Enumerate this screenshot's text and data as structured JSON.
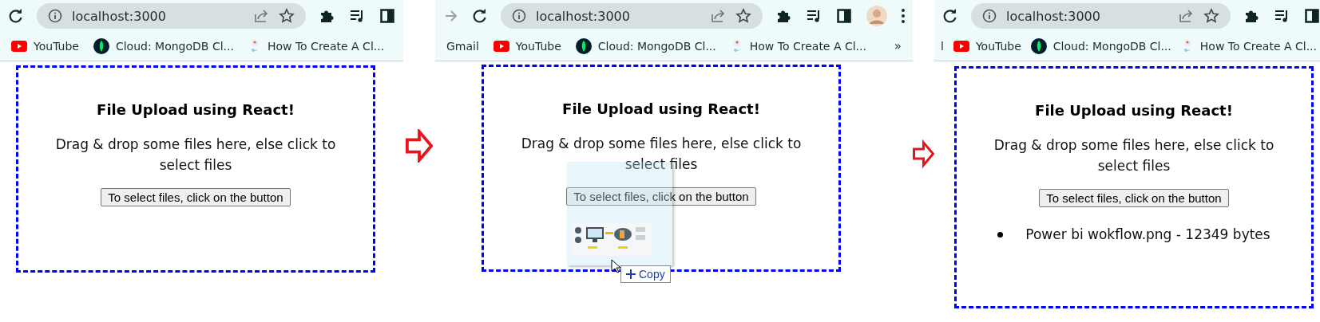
{
  "panels": [
    {
      "toolbar": {
        "nav": [
          {
            "kind": "reload",
            "disabled": false
          }
        ],
        "url": "localhost:3000",
        "actions": [
          {
            "kind": "extensions"
          },
          {
            "kind": "media"
          },
          {
            "kind": "sidepanel"
          }
        ]
      },
      "bookmarks": [
        {
          "label": "YouTube",
          "kind": "youtube"
        },
        {
          "label": "Cloud: MongoDB Cl...",
          "kind": "mongodb"
        },
        {
          "label": "How To Create A Cl...",
          "kind": "site"
        }
      ],
      "card": {
        "title": "File Upload using React!",
        "text": "Drag & drop some files here, else click to select files",
        "button": "To select files, click on the button"
      }
    },
    {
      "toolbar": {
        "nav": [
          {
            "kind": "forward",
            "disabled": true
          },
          {
            "kind": "reload",
            "disabled": false
          }
        ],
        "url": "localhost:3000",
        "actions": [
          {
            "kind": "extensions"
          },
          {
            "kind": "media"
          },
          {
            "kind": "sidepanel"
          },
          {
            "kind": "avatar"
          },
          {
            "kind": "menu"
          }
        ]
      },
      "bookmarks": [
        {
          "label": "Gmail",
          "kind": "plain"
        },
        {
          "label": "YouTube",
          "kind": "youtube"
        },
        {
          "label": "Cloud: MongoDB Cl...",
          "kind": "mongodb"
        },
        {
          "label": "How To Create A Cl...",
          "kind": "site"
        }
      ],
      "overflow": "»",
      "card": {
        "title": "File Upload using React!",
        "text": "Drag & drop some files here, else click to select files",
        "button": "To select files, click on the button"
      },
      "drag": {
        "action": "Copy"
      }
    },
    {
      "toolbar": {
        "nav": [
          {
            "kind": "reload",
            "disabled": false
          }
        ],
        "url": "localhost:3000",
        "actions": [
          {
            "kind": "extensions"
          },
          {
            "kind": "media"
          },
          {
            "kind": "sidepanel"
          }
        ]
      },
      "bookmarks": [
        {
          "label": "l",
          "kind": "plain"
        },
        {
          "label": "YouTube",
          "kind": "youtube"
        },
        {
          "label": "Cloud: MongoDB Cl...",
          "kind": "mongodb"
        },
        {
          "label": "How To Create A Cl...",
          "kind": "site"
        }
      ],
      "card": {
        "title": "File Upload using React!",
        "text": "Drag & drop some files here, else click to select files",
        "button": "To select files, click on the button",
        "files": [
          "Power bi wokflow.png - 12349 bytes"
        ]
      }
    }
  ]
}
